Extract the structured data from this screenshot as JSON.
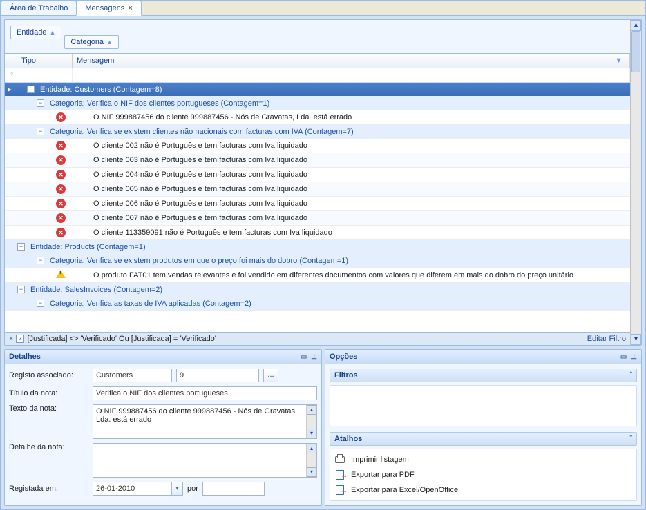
{
  "tabs": [
    {
      "label": "Área de Trabalho"
    },
    {
      "label": "Mensagens",
      "active": true,
      "closable": true
    }
  ],
  "groupBy": [
    {
      "label": "Entidade"
    },
    {
      "label": "Categoria"
    }
  ],
  "columns": {
    "tipo": "Tipo",
    "msg": "Mensagem"
  },
  "rows": [
    {
      "kind": "g1",
      "text": "Entidade: Customers (Contagem=8)",
      "indent": 0
    },
    {
      "kind": "g2",
      "text": "Categoria: Verifica o NIF dos clientes portugueses (Contagem=1)",
      "indent": 1
    },
    {
      "kind": "d",
      "icon": "err",
      "text": "O NIF 999887456 do cliente 999887456 - Nós de Gravatas, Lda. está errado",
      "indent": 2,
      "odd": false
    },
    {
      "kind": "g2",
      "text": "Categoria: Verifica se existem clientes não nacionais com facturas com IVA (Contagem=7)",
      "indent": 1
    },
    {
      "kind": "d",
      "icon": "err",
      "text": "O cliente 002 não é Português e tem facturas com Iva liquidado",
      "indent": 2,
      "odd": false
    },
    {
      "kind": "d",
      "icon": "err",
      "text": "O cliente 003 não é Português e tem facturas com Iva liquidado",
      "indent": 2,
      "odd": true
    },
    {
      "kind": "d",
      "icon": "err",
      "text": "O cliente 004 não é Português e tem facturas com Iva liquidado",
      "indent": 2,
      "odd": false
    },
    {
      "kind": "d",
      "icon": "err",
      "text": "O cliente 005 não é Português e tem facturas com Iva liquidado",
      "indent": 2,
      "odd": true
    },
    {
      "kind": "d",
      "icon": "err",
      "text": "O cliente 006 não é Português e tem facturas com Iva liquidado",
      "indent": 2,
      "odd": false
    },
    {
      "kind": "d",
      "icon": "err",
      "text": "O cliente 007 não é Português e tem facturas com Iva liquidado",
      "indent": 2,
      "odd": true
    },
    {
      "kind": "d",
      "icon": "err",
      "text": "O cliente 113359091 não é Português e tem facturas com Iva liquidado",
      "indent": 2,
      "odd": false
    },
    {
      "kind": "g2",
      "text": "Entidade: Products (Contagem=1)",
      "indent": 0
    },
    {
      "kind": "g2",
      "text": "Categoria: Verifica se existem produtos em que o preço foi mais do dobro (Contagem=1)",
      "indent": 1
    },
    {
      "kind": "d",
      "icon": "warn",
      "text": "O produto FAT01 tem vendas relevantes e foi vendido em diferentes documentos com valores que diferem em mais do dobro do preço unitário",
      "indent": 2,
      "odd": false
    },
    {
      "kind": "g2",
      "text": "Entidade: SalesInvoices (Contagem=2)",
      "indent": 0
    },
    {
      "kind": "g2",
      "text": "Categoria: Verifica as taxas de IVA aplicadas (Contagem=2)",
      "indent": 1
    }
  ],
  "filterBar": {
    "expr": "[Justificada] <> 'Verificado' Ou [Justificada] = 'Verificado'",
    "editLink": "Editar Filtro",
    "closeGlyph": "×",
    "checked": "✓"
  },
  "details": {
    "title": "Detalhes",
    "registoLabel": "Registo associado:",
    "registoVal1": "Customers",
    "registoVal2": "9",
    "dots": "...",
    "tituloLabel": "Título da nota:",
    "tituloVal": "Verifica o NIF dos clientes portugueses",
    "textoLabel": "Texto da nota:",
    "textoVal": "O NIF 999887456 do cliente 999887456 - Nós de Gravatas, Lda. está errado",
    "detalheLabel": "Detalhe da nota:",
    "detalheVal": "",
    "registadaLabel": "Registada em:",
    "registadaVal": "26-01-2010",
    "porLabel": "por",
    "porVal": ""
  },
  "opts": {
    "title": "Opções",
    "filtros": "Filtros",
    "atalhos": "Atalhos",
    "items": [
      {
        "icon": "print",
        "label": "Imprimir listagem"
      },
      {
        "icon": "export",
        "label": "Exportar para PDF"
      },
      {
        "icon": "export",
        "label": "Exportar para Excel/OpenOffice"
      }
    ]
  },
  "glyphs": {
    "minus": "−",
    "sortUp": "▲",
    "chevDown": "▾",
    "chevUp": "˄",
    "pin": "📌",
    "max": "▭",
    "close": "✕"
  }
}
